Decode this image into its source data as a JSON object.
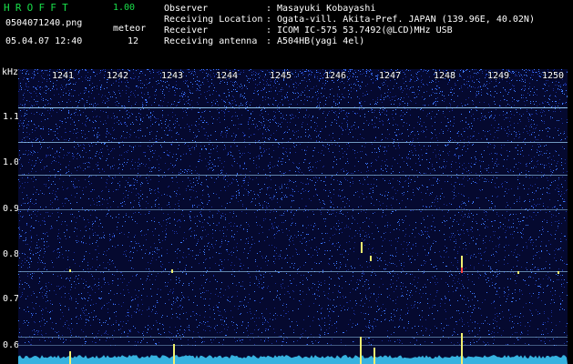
{
  "app": {
    "title": "HROFFT",
    "version": "1.00"
  },
  "file": {
    "name": "0504071240.png",
    "datetime": "05.04.07 12:40"
  },
  "meteor": {
    "label": "meteor",
    "count": "12"
  },
  "info": [
    {
      "label": "Observer",
      "value": "Masayuki Kobayashi"
    },
    {
      "label": "Receiving Location",
      "value": "Ogata-vill. Akita-Pref. JAPAN (139.96E, 40.02N)"
    },
    {
      "label": "Receiver",
      "value": "ICOM IC-575 53.7492(@LCD)MHz USB"
    },
    {
      "label": "Receiving antenna",
      "value": "A504HB(yagi 4el)"
    }
  ],
  "spectrogram": {
    "unit_label": "kHz",
    "y_ticks": [
      "1.1",
      "1.0",
      "0.9",
      "0.8",
      "0.7",
      "0.6"
    ],
    "time_labels": [
      "1241",
      "1242",
      "1243",
      "1244",
      "1245",
      "1246",
      "1247",
      "1248",
      "1249",
      "1250"
    ],
    "colors": {
      "background": "#05092f",
      "noise_low": "#1a2f9a",
      "noise_high": "#3f7bff",
      "carrier": "#9fd8ff",
      "meteor": "#f0f070",
      "meteor_core": "#ff4040",
      "baseline": "#3fd0ff"
    }
  }
}
